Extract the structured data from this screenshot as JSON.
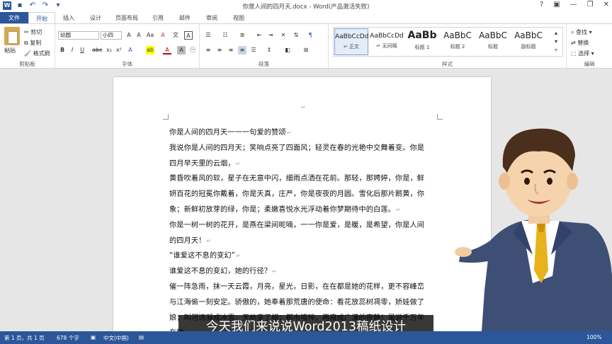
{
  "window": {
    "title": "你是人间的四月天.docx - Word(产品激活失败)",
    "controls": [
      "?",
      "▣",
      "—",
      "❐",
      "✕"
    ]
  },
  "tabs": [
    {
      "label": "文件"
    },
    {
      "label": "开始"
    },
    {
      "label": "插入"
    },
    {
      "label": "设计"
    },
    {
      "label": "页面布局"
    },
    {
      "label": "引用"
    },
    {
      "label": "邮件"
    },
    {
      "label": "审阅"
    },
    {
      "label": "视图"
    }
  ],
  "ribbon": {
    "clipboard": {
      "paste": "粘贴",
      "cut": "剪切",
      "copy": "复制",
      "format_painter": "格式刷",
      "group": "剪贴板"
    },
    "font": {
      "family": "幼圆",
      "size": "小四",
      "group": "字体"
    },
    "paragraph": {
      "group": "段落"
    },
    "styles": {
      "group": "样式",
      "items": [
        {
          "preview": "AaBbCcDd",
          "name": "↵ 正文"
        },
        {
          "preview": "AaBbCcDd",
          "name": "↵ 无间隔"
        },
        {
          "preview": "AaBb",
          "name": "标题 1"
        },
        {
          "preview": "AaBbC",
          "name": "标题 2"
        },
        {
          "preview": "AaBbC",
          "name": "标题"
        },
        {
          "preview": "AaBbC",
          "name": "副标题"
        }
      ]
    },
    "editing": {
      "find": "查找",
      "replace": "替换",
      "select": "选择",
      "group": "编辑"
    }
  },
  "document": {
    "lines": [
      "你是人间的四月天一一一句爱的赞颂",
      "我说你是人间的四月天；笑响点亮了四面风；轻灵在春的光艳中交舞着变。你是",
      "四月早天里的云烟，",
      "黄昏吹着风的软，星子在无意中闪，细雨点洒在花前。那轻，那娉婷，你是，鲜",
      "妍百花的冠冕你戴着，你是天真，庄严，你是夜夜的月圆。雪化后那片鹅黄，你",
      "象；新鲜初放芽的绿，你是；柔嫩喜悦水光浮动着你梦期待中的白莲。",
      "你是一树一树的花开，是燕在梁间呢喃，一一你是爱，是暖，是希望，你是人间",
      "的四月天！",
      "“谁爱这不息的变幻”",
      "谁爱这不息的变幻，她的行径？",
      "催一阵急雨，抹一天云霞，月亮，星光，日影，在在都是她的花样，更不容峰峦",
      "与江海偷一刻安定。骄傲的，她奉着那荒唐的使命：看花放蕊树凋零，娇娃做了",
      "娘；叫河流凝成冰雪，天地变了相；都市喧哗，再寂成广漠的夜静！虽说千万年",
      "在她"
    ],
    "return_marks": [
      true,
      false,
      true,
      false,
      false,
      true,
      false,
      true,
      true,
      true,
      false,
      false,
      false,
      false
    ]
  },
  "subtitle": "今天我们来说说Word2013稿纸设计",
  "status": {
    "page": "第 1 页，共 1 页",
    "words": "678 个字",
    "language": "中文(中国)",
    "zoom": "100%"
  }
}
